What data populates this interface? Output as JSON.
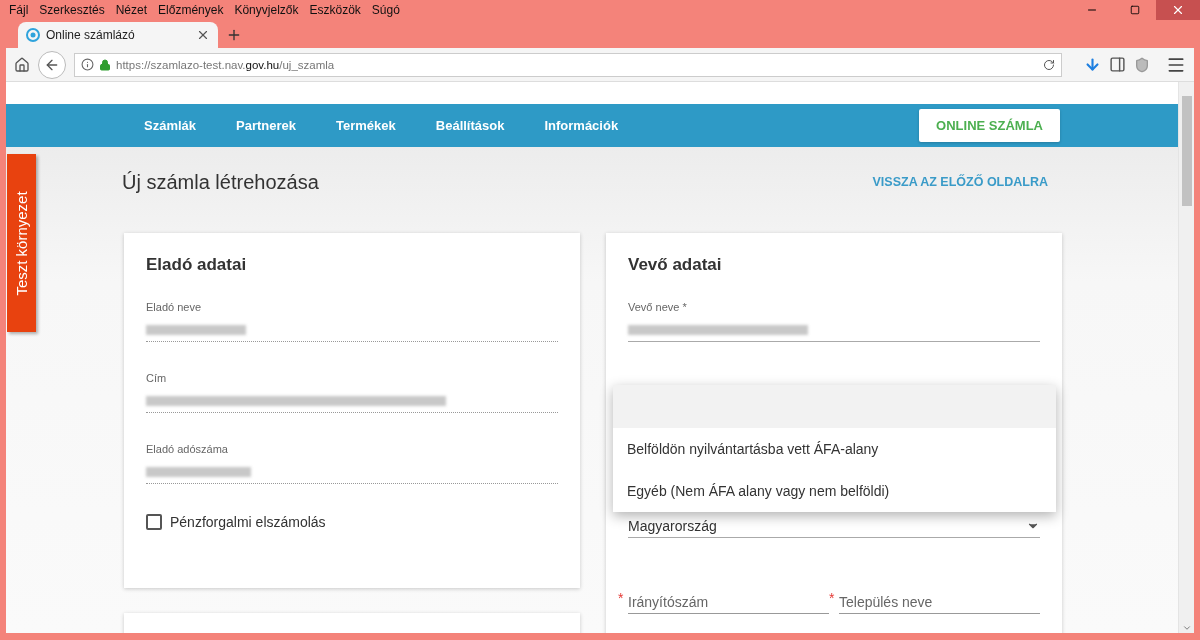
{
  "browser": {
    "menu": [
      "Fájl",
      "Szerkesztés",
      "Nézet",
      "Előzmények",
      "Könyvjelzők",
      "Eszközök",
      "Súgó"
    ],
    "tab": {
      "title": "Online számlázó"
    },
    "address": "https://szamlazo-test.nav.**gov.hu**/uj_szamla"
  },
  "site": {
    "nav": [
      "Számlák",
      "Partnerek",
      "Termékek",
      "Beállítások",
      "Információk"
    ],
    "cta": "ONLINE SZÁMLA",
    "env_badge": "Teszt környezet"
  },
  "page": {
    "title": "Új számla létrehozása",
    "back_link": "VISSZA AZ ELŐZŐ OLDALRA"
  },
  "seller": {
    "title": "Eladó adatai",
    "fields": [
      {
        "label": "Eladó neve"
      },
      {
        "label": "Cím"
      },
      {
        "label": "Eladó adószáma"
      }
    ],
    "checkbox": {
      "label": "Pénzforgalmi elszámolás",
      "checked": false
    }
  },
  "buyer": {
    "title": "Vevő adatai",
    "fields": [
      {
        "kind": "text",
        "label": "Vevő neve *"
      },
      {
        "kind": "select",
        "value": "Magyarország"
      }
    ],
    "address_row": [
      {
        "mark": "*",
        "placeholder": "Irányítószám"
      },
      {
        "mark": "*",
        "placeholder": "Település neve"
      }
    ],
    "dropdown": [
      {
        "selected": true
      },
      {
        "label": "Belföldön nyilvántartásba vett ÁFA-alany",
        "selected": false
      },
      {
        "label": "Egyéb (Nem ÁFA alany vagy nem belföldi)",
        "selected": false
      }
    ]
  }
}
